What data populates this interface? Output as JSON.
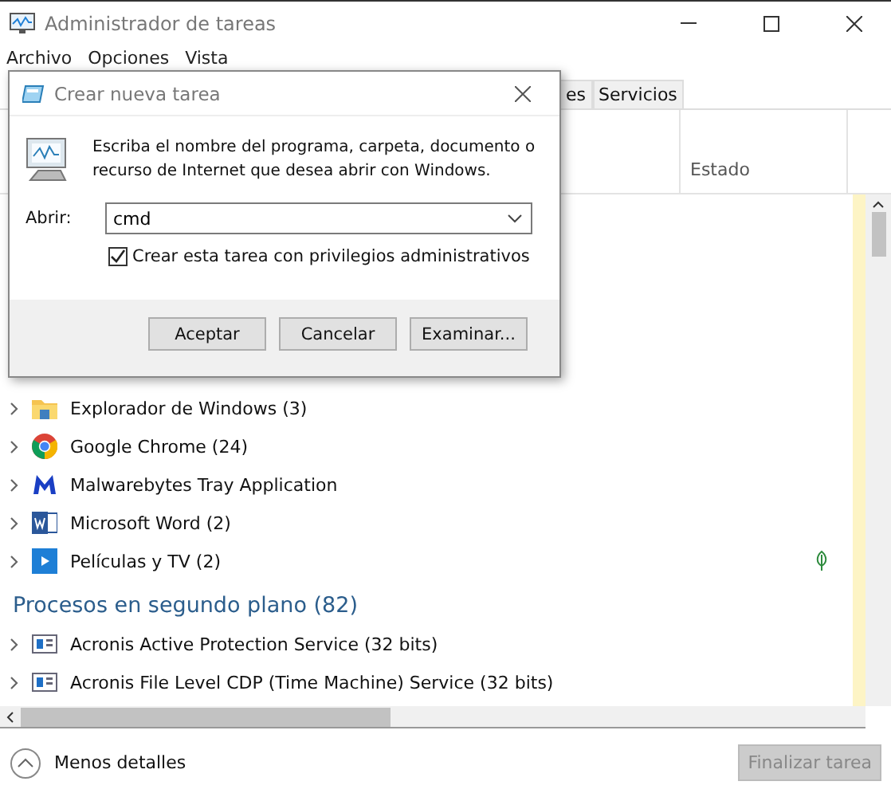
{
  "window": {
    "title": "Administrador de tareas"
  },
  "menu": [
    "Archivo",
    "Opciones",
    "Vista"
  ],
  "tabs": [
    {
      "label": "es",
      "selected": false
    },
    {
      "label": "Servicios",
      "selected": false
    }
  ],
  "columns": [
    {
      "label": "Estado"
    }
  ],
  "apps": [
    {
      "name": "Explorador de Windows (3)",
      "kind": "folder",
      "eco": false
    },
    {
      "name": "Google Chrome (24)",
      "kind": "browser",
      "eco": false
    },
    {
      "name": "Malwarebytes Tray Application",
      "kind": "security",
      "eco": false
    },
    {
      "name": "Microsoft Word (2)",
      "kind": "document",
      "eco": false
    },
    {
      "name": "Películas y TV (2)",
      "kind": "video",
      "eco": true
    }
  ],
  "background": {
    "title": "Procesos en segundo plano (82)",
    "rows": [
      {
        "name": "Acronis Active Protection Service (32 bits)",
        "kind": "service"
      },
      {
        "name": "Acronis File Level CDP (Time Machine) Service (32 bits)",
        "kind": "service"
      }
    ]
  },
  "footer": {
    "details": "Menos detalles",
    "end_task": {
      "label": "Finalizar tarea",
      "disabled": true
    }
  },
  "dialog": {
    "title": "Crear nueva tarea",
    "message": "Escriba el nombre del programa, carpeta, documento o recurso de Internet que desea abrir con Windows.",
    "open_label": "Abrir:",
    "open_value": "cmd",
    "admin": {
      "label": "Crear esta tarea con privilegios administrativos",
      "checked": true
    },
    "buttons": [
      "Aceptar",
      "Cancelar",
      "Examinar..."
    ]
  }
}
